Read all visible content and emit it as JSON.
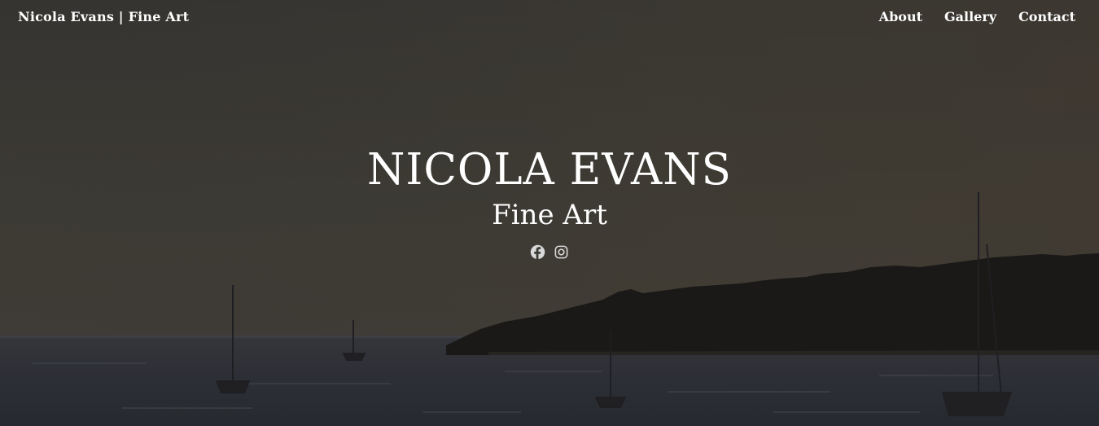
{
  "header": {
    "brand": "Nicola Evans | Fine Art",
    "nav": [
      {
        "label": "About"
      },
      {
        "label": "Gallery"
      },
      {
        "label": "Contact"
      }
    ]
  },
  "hero": {
    "title": "NICOLA EVANS",
    "subtitle": "Fine Art",
    "social": [
      {
        "icon": "facebook-icon"
      },
      {
        "icon": "instagram-icon"
      }
    ]
  },
  "colors": {
    "text": "#ffffff",
    "icon": "#d9d9d9",
    "sky": "#3f3e3b",
    "sea": "#33353b",
    "land": "#1c1b18"
  }
}
